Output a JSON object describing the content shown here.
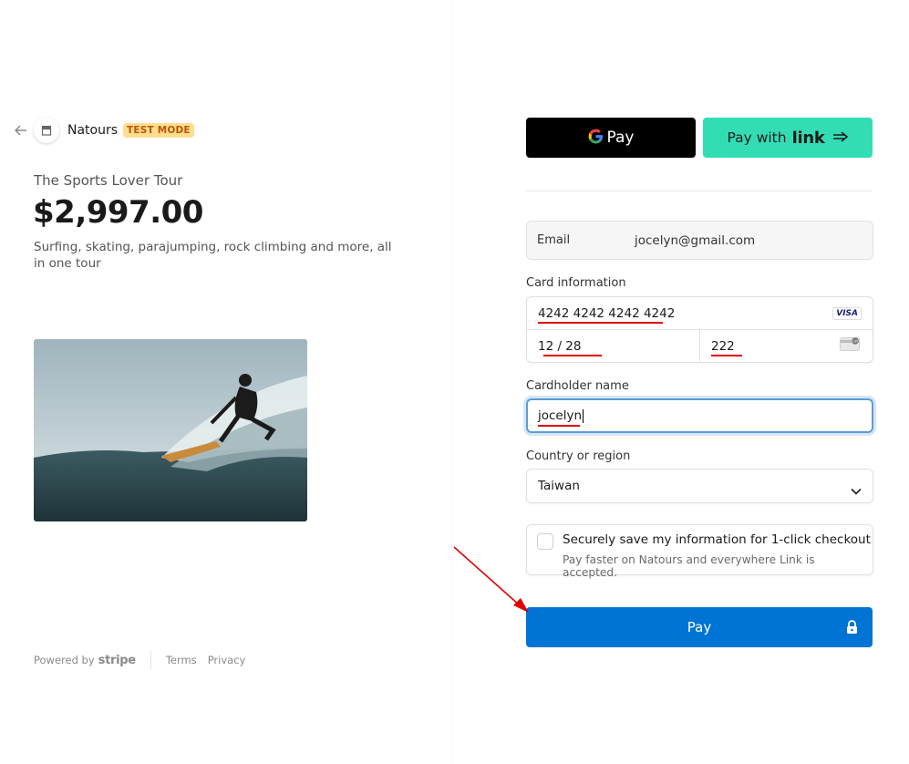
{
  "merchant": {
    "name": "Natours",
    "badge": "TEST MODE"
  },
  "product": {
    "name": "The Sports Lover Tour",
    "price": "$2,997.00",
    "description": "Surfing, skating, parajumping, rock climbing and more, all in one tour"
  },
  "footer": {
    "powered_by": "Powered by",
    "brand": "stripe",
    "terms": "Terms",
    "privacy": "Privacy"
  },
  "express": {
    "gpay_label": "Pay",
    "link_label": "Pay with",
    "link_brand": "link"
  },
  "form": {
    "email_label": "Email",
    "email_value": "jocelyn@gmail.com",
    "card_label": "Card information",
    "card_number": "4242 4242 4242 4242",
    "card_brand": "VISA",
    "expiry": "12 / 28",
    "cvc": "222",
    "cardholder_label": "Cardholder name",
    "cardholder_value": "jocelyn",
    "country_label": "Country or region",
    "country_value": "Taiwan",
    "save_title": "Securely save my information for 1-click checkout",
    "save_subtitle": "Pay faster on Natours and everywhere Link is accepted.",
    "pay_label": "Pay"
  },
  "colors": {
    "test_badge_bg": "#ffde92",
    "test_badge_text": "#bb5504",
    "link_green": "#33ddb3",
    "pay_blue": "#0074d4",
    "annotation_red": "#e00000"
  },
  "icons": {
    "back": "back-arrow-icon",
    "store": "store-icon",
    "google": "google-g-icon",
    "link_arrow": "link-arrow-icon",
    "cvc": "cvc-card-icon",
    "chevron": "chevron-down-icon",
    "lock": "lock-icon"
  }
}
